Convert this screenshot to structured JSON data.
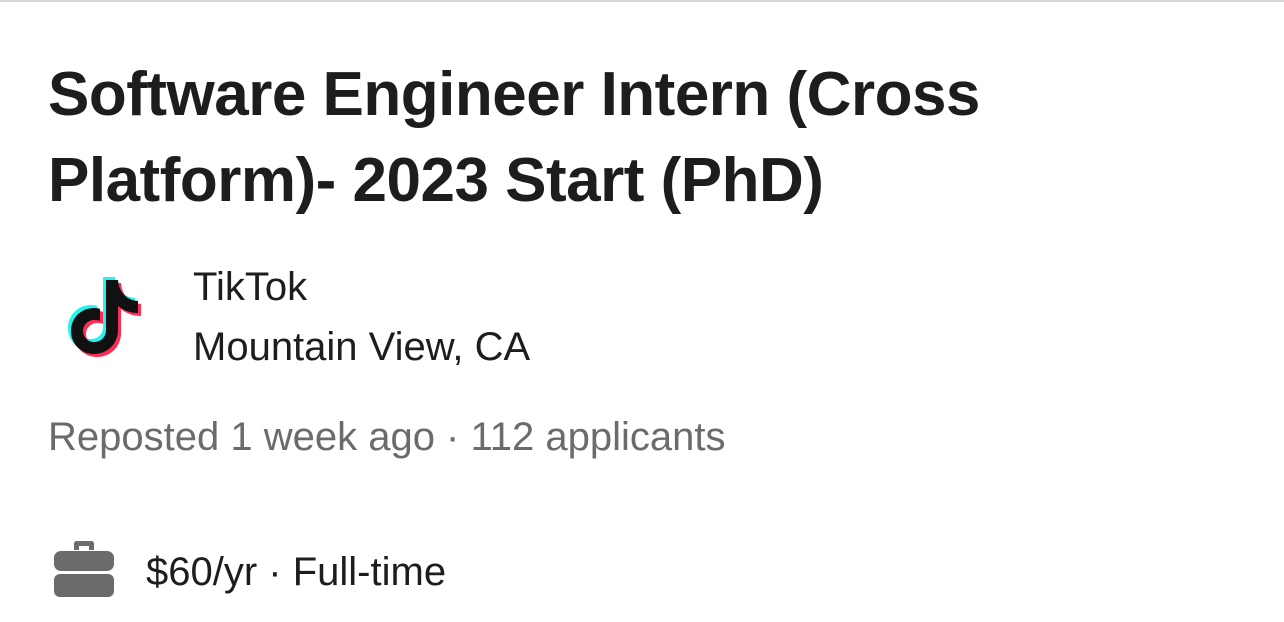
{
  "job": {
    "title": "Software Engineer Intern (Cross Platform)- 2023 Start (PhD)",
    "company": "TikTok",
    "location": "Mountain View, CA",
    "posted": "Reposted 1 week ago",
    "separator": " · ",
    "applicants": "112 applicants",
    "salary": "$60/yr",
    "employment_type": "Full-time"
  },
  "icons": {
    "company_logo": "tiktok-logo-icon",
    "job_type": "briefcase-icon"
  },
  "colors": {
    "title_text": "#1d1d1d",
    "secondary_text": "#6b6b6b",
    "briefcase": "#6b6b6b",
    "tiktok_cyan": "#25f4ee",
    "tiktok_red": "#fe2c55",
    "tiktok_black": "#111111"
  }
}
